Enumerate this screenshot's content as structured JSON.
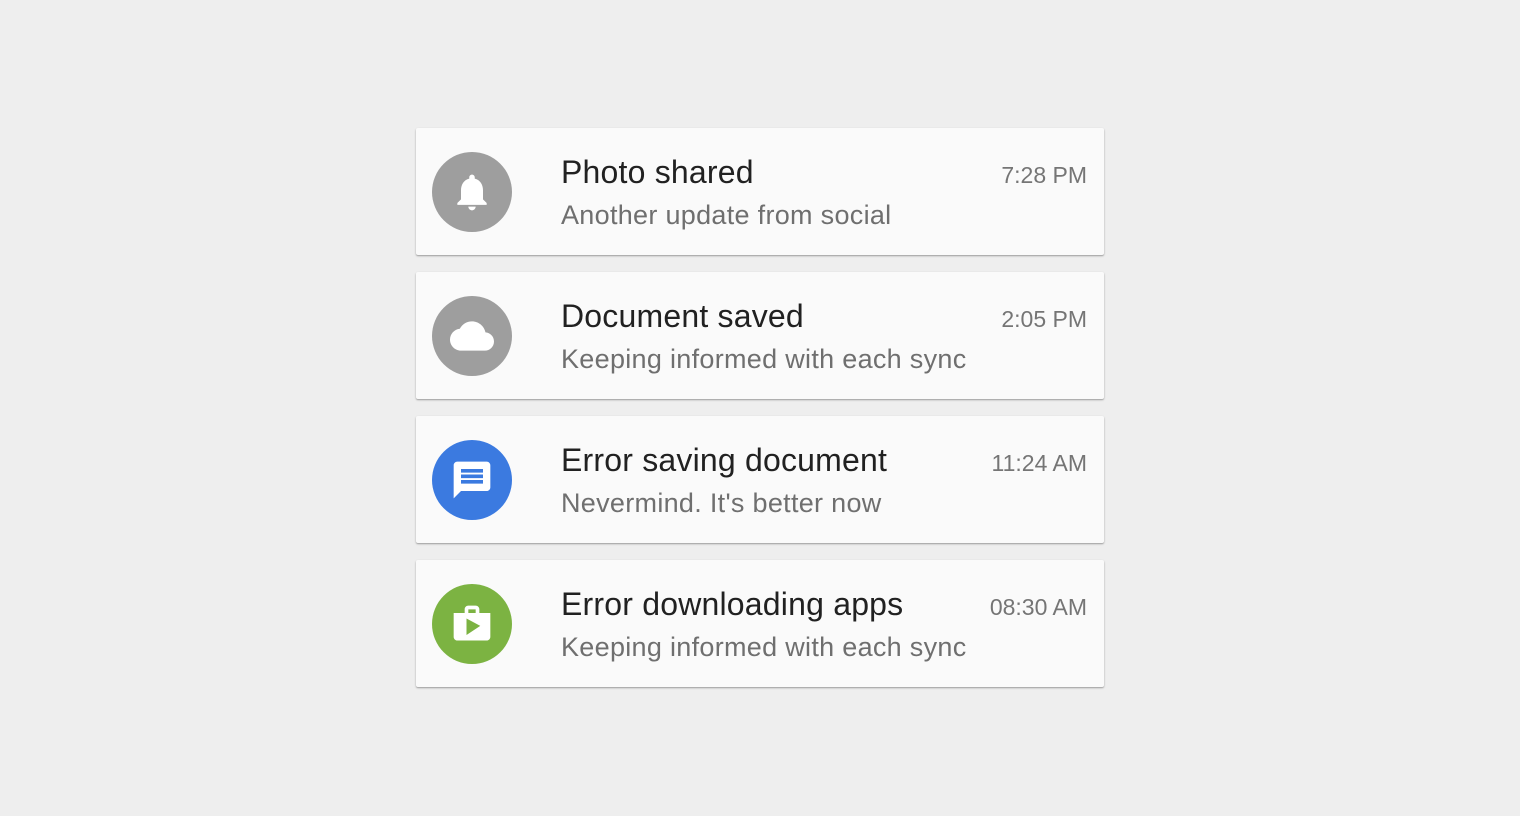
{
  "notifications": [
    {
      "title": "Photo shared",
      "subtitle": "Another update from social",
      "time": "7:28 PM",
      "icon": "bell-icon",
      "color": "#9e9e9e"
    },
    {
      "title": "Document saved",
      "subtitle": "Keeping informed with each sync",
      "time": "2:05 PM",
      "icon": "cloud-icon",
      "color": "#9e9e9e"
    },
    {
      "title": "Error saving document",
      "subtitle": "Nevermind. It's better now",
      "time": "11:24 AM",
      "icon": "message-icon",
      "color": "#3b7ae0"
    },
    {
      "title": "Error downloading apps",
      "subtitle": "Keeping informed with each sync",
      "time": "08:30 AM",
      "icon": "play-store-icon",
      "color": "#7cb342"
    }
  ]
}
